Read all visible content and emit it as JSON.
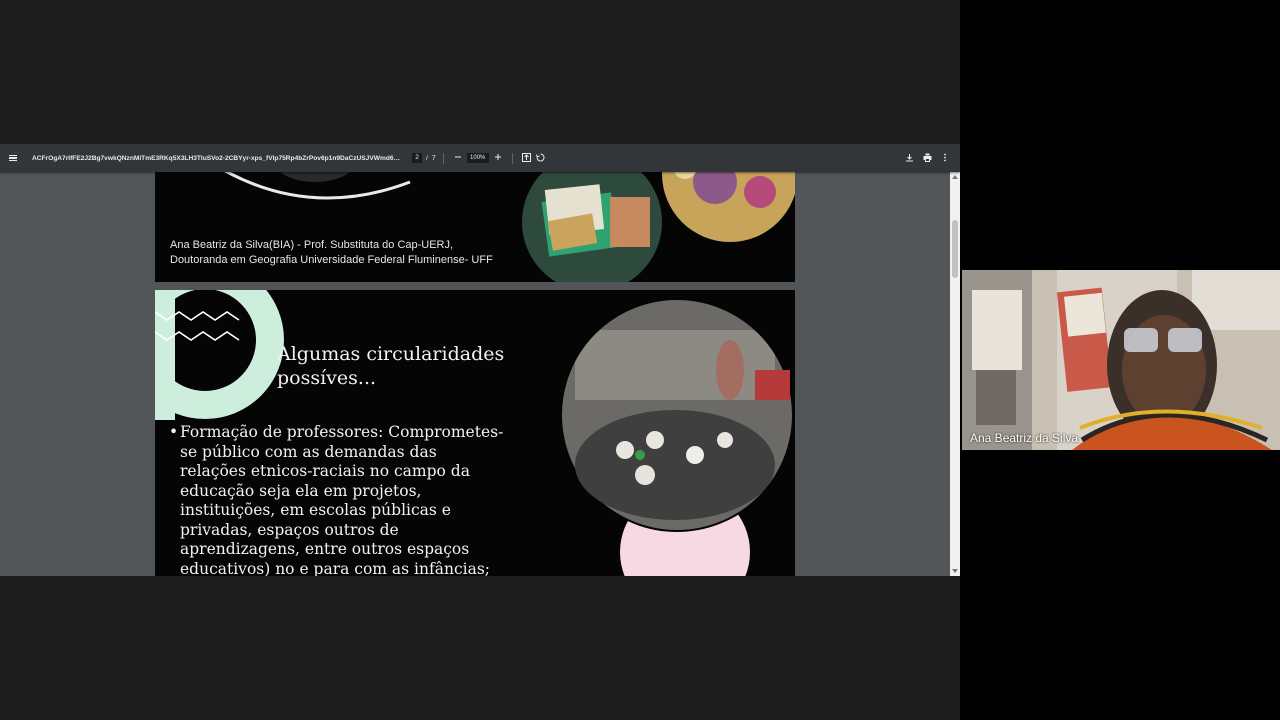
{
  "viewer": {
    "title": "ACFrOgA7rIfFE2J2Bg7vwkQNznMiTmE3RKq5X3LH3TluSVo2-2CBYyr-xps_fVlp75Rp4bZrPov6p1n9DaCzUSJVWmd66zj...",
    "page_current": "2",
    "page_separator": "/",
    "page_total": "7",
    "zoom": "100%",
    "zoom_out_icon": "minus-icon",
    "zoom_in_icon": "plus-icon"
  },
  "slide1": {
    "caption_line1": "Ana Beatriz da Silva(BIA) - Prof. Substituta do Cap-UERJ,",
    "caption_line2": "Doutoranda em Geografia Universidade Federal  Fluminense- UFF"
  },
  "slide2": {
    "title_line1": "Algumas circularidades",
    "title_line2": "possíves...",
    "bullet_symbol": "•",
    "bullet_text": "Formação  de professores: Comprometes-se  público com as demandas das relações etnicos-raciais no campo da educação seja ela em projetos, instituições, em  escolas públicas e privadas, espaços outros de aprendizagens, entre outros espaços educativos) no e para com as infâncias;",
    "bullet_lines": [
      "Formação  de professores: Comprometes-",
      "se  público com as demandas das",
      "relações etnicos-raciais no campo da",
      "educação seja ela em projetos,",
      "instituições, em  escolas públicas e",
      "privadas, espaços outros de",
      "aprendizagens, entre outros espaços",
      "educativos) no e para com as infâncias;"
    ]
  },
  "participant": {
    "name": "Ana Beatriz da Silva"
  },
  "colors": {
    "toolbar": "#323639",
    "viewer_bg": "#525659",
    "slide_bg": "#050505",
    "mint": "#cdeedd",
    "pink": "#f7d9e4"
  }
}
